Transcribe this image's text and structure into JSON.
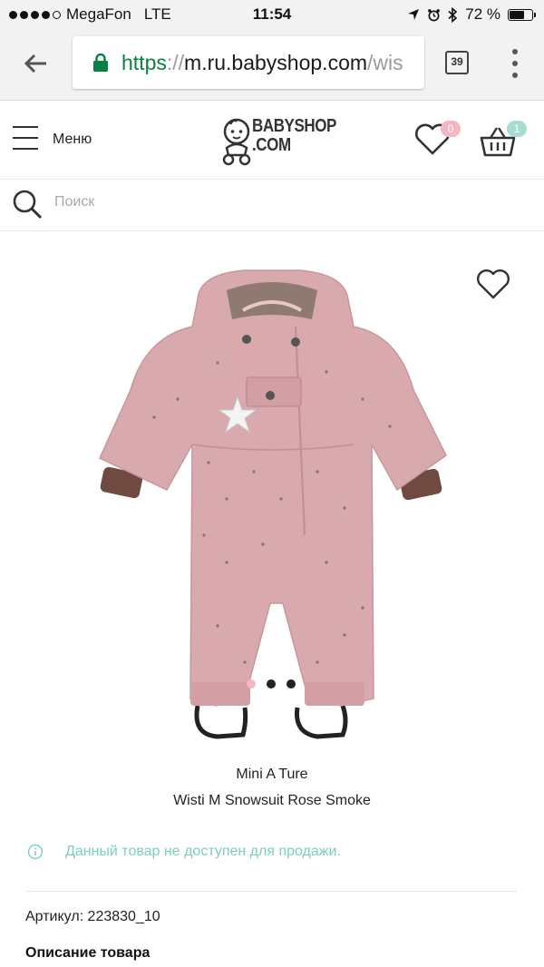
{
  "status_bar": {
    "carrier": "MegaFon",
    "network": "LTE",
    "time": "11:54",
    "battery": "72 %",
    "battery_level": 0.72
  },
  "browser": {
    "url_scheme": "https",
    "url_sep": "://",
    "url_host": "m.ru.babyshop.com",
    "url_path": "/wis",
    "tab_count": "39"
  },
  "header": {
    "menu_label": "Меню",
    "logo_line1": "BABYSHOP",
    "logo_line2": ".COM",
    "wishlist_count": "0",
    "cart_count": "1",
    "colors": {
      "wish_badge": "#f4b6c2",
      "cart_badge": "#a8dcd1"
    }
  },
  "search": {
    "placeholder": "Поиск"
  },
  "product": {
    "brand": "Mini A Ture",
    "name": "Wisti M Snowsuit Rose Smoke",
    "image": "pink-snowsuit-image",
    "carousel_active": 1,
    "carousel_total": 3,
    "availability": "Данный товар не доступен для продажи.",
    "sku_label": "Артикул:",
    "sku": "223830_10",
    "description_title": "Описание товара",
    "colors": {
      "suit": "#d8a9ad",
      "accent": "#7ccfbd"
    }
  }
}
